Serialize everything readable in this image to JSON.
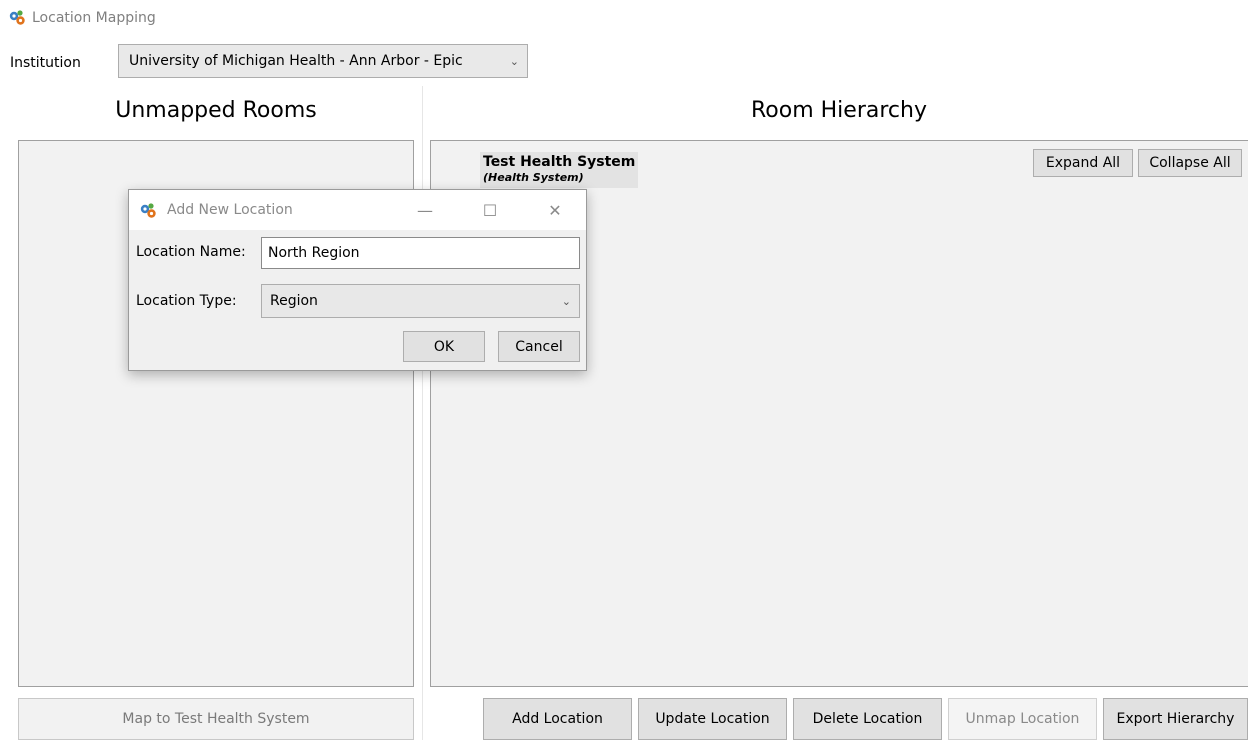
{
  "window": {
    "title": "Location Mapping",
    "icon": "gear-icon"
  },
  "institution": {
    "label": "Institution",
    "selected": "University of Michigan Health - Ann Arbor - Epic"
  },
  "unmapped": {
    "heading": "Unmapped Rooms",
    "map_button": "Map to Test Health System"
  },
  "hierarchy": {
    "heading": "Room Hierarchy",
    "expand_all": "Expand All",
    "collapse_all": "Collapse All",
    "root": {
      "name": "Test Health System",
      "type": "(Health System)"
    },
    "buttons": {
      "add": "Add Location",
      "update": "Update Location",
      "delete": "Delete Location",
      "unmap": "Unmap Location",
      "export": "Export Hierarchy"
    }
  },
  "dialog": {
    "title": "Add New Location",
    "name_label": "Location Name:",
    "name_value": "North Region",
    "type_label": "Location Type:",
    "type_value": "Region",
    "ok": "OK",
    "cancel": "Cancel"
  },
  "colors": {
    "panel_bg": "#f2f2f2",
    "button_bg": "#e1e1e1",
    "disabled_text": "#8a8a8a"
  }
}
